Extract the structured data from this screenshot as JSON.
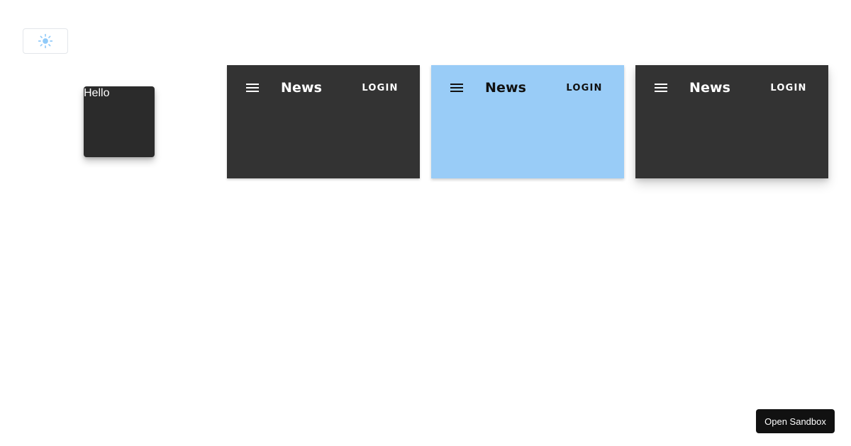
{
  "theme_toggle": {
    "icon": "sun-icon",
    "icon_color": "#90caf9"
  },
  "hello_box": {
    "text": "Hello",
    "background": "#2b2b2b",
    "text_color": "#ffffff"
  },
  "app_bars": [
    {
      "title": "News",
      "login_label": "LOGIN",
      "background": "#333333",
      "foreground": "#ffffff",
      "menu_icon": "menu-icon"
    },
    {
      "title": "News",
      "login_label": "LOGIN",
      "background": "#99ccf7",
      "foreground": "#111111",
      "menu_icon": "menu-icon"
    },
    {
      "title": "News",
      "login_label": "LOGIN",
      "background": "#333333",
      "foreground": "#ffffff",
      "menu_icon": "menu-icon"
    }
  ],
  "sandbox": {
    "label": "Open Sandbox"
  }
}
